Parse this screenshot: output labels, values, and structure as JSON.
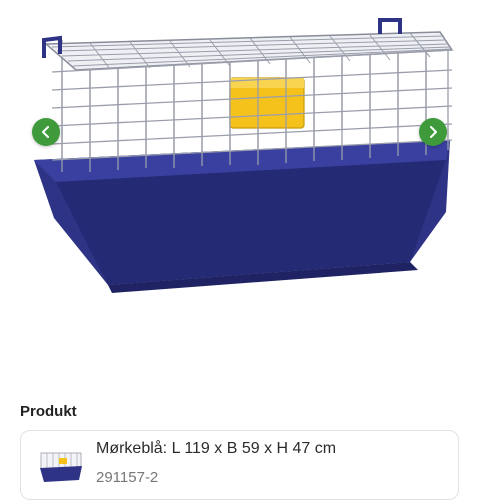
{
  "gallery": {
    "image": "rabbit-cage-product-image",
    "prev_icon": "chevron-left-icon",
    "next_icon": "chevron-right-icon",
    "arrow_color": "#3f9a3c",
    "cage_base_color": "#2e3386",
    "feeder_color": "#f5c21c"
  },
  "product_section": {
    "title": "Produkt",
    "variant": {
      "name": "Mørkeblå: L 119 x B 59 x H 47 cm",
      "sku": "291157-2"
    }
  }
}
